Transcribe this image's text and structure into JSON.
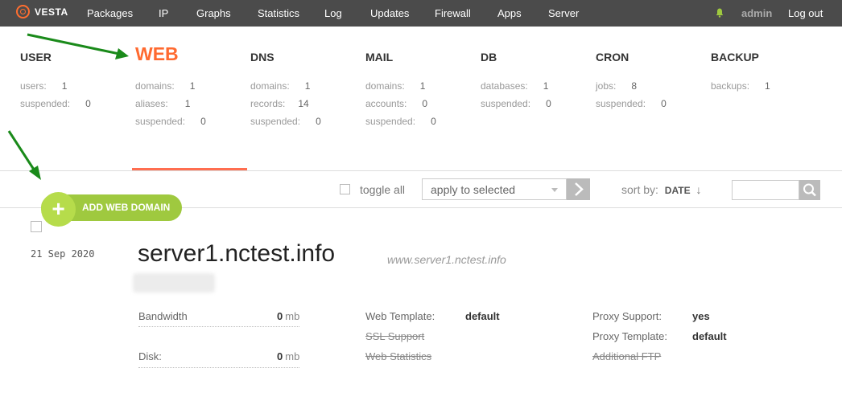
{
  "topbar": {
    "logo": "VESTA",
    "nav": [
      "Packages",
      "IP",
      "Graphs",
      "Statistics",
      "Log",
      "Updates",
      "Firewall",
      "Apps",
      "Server"
    ],
    "user": "admin",
    "logout": "Log out"
  },
  "stats": [
    {
      "title": "USER",
      "rows": [
        {
          "label": "users:",
          "value": "1"
        },
        {
          "label": "suspended:",
          "value": "0"
        }
      ]
    },
    {
      "title": "WEB",
      "rows": [
        {
          "label": "domains:",
          "value": "1"
        },
        {
          "label": "aliases:",
          "value": "1"
        },
        {
          "label": "suspended:",
          "value": "0"
        }
      ]
    },
    {
      "title": "DNS",
      "rows": [
        {
          "label": "domains:",
          "value": "1"
        },
        {
          "label": "records:",
          "value": "14"
        },
        {
          "label": "suspended:",
          "value": "0"
        }
      ]
    },
    {
      "title": "MAIL",
      "rows": [
        {
          "label": "domains:",
          "value": "1"
        },
        {
          "label": "accounts:",
          "value": "0"
        },
        {
          "label": "suspended:",
          "value": "0"
        }
      ]
    },
    {
      "title": "DB",
      "rows": [
        {
          "label": "databases:",
          "value": "1"
        },
        {
          "label": "suspended:",
          "value": "0"
        }
      ]
    },
    {
      "title": "CRON",
      "rows": [
        {
          "label": "jobs:",
          "value": "8"
        },
        {
          "label": "suspended:",
          "value": "0"
        }
      ]
    },
    {
      "title": "BACKUP",
      "rows": [
        {
          "label": "backups:",
          "value": "1"
        }
      ]
    }
  ],
  "toolbar": {
    "add_label": "ADD WEB DOMAIN",
    "toggle_all": "toggle all",
    "apply_select": "apply to selected",
    "sort_label": "sort by:",
    "sort_value": "DATE",
    "sort_arrow": "↓"
  },
  "domain_row": {
    "date": "21 Sep 2020",
    "name": "server1.nctest.info",
    "alias": "www.server1.nctest.info",
    "bandwidth_label": "Bandwidth",
    "bandwidth_value": "0",
    "disk_label": "Disk:",
    "disk_value": "0",
    "unit": "mb",
    "web_template_label": "Web Template:",
    "web_template_value": "default",
    "ssl_label": "SSL Support",
    "web_stats_label": "Web Statistics",
    "proxy_support_label": "Proxy Support:",
    "proxy_support_value": "yes",
    "proxy_template_label": "Proxy Template:",
    "proxy_template_value": "default",
    "ftp_label": "Additional FTP"
  },
  "colors": {
    "accent": "#ff6a30",
    "topbar": "#4b4b4b",
    "add_button": "#9fc93f",
    "arrow": "#1a8a1a"
  }
}
